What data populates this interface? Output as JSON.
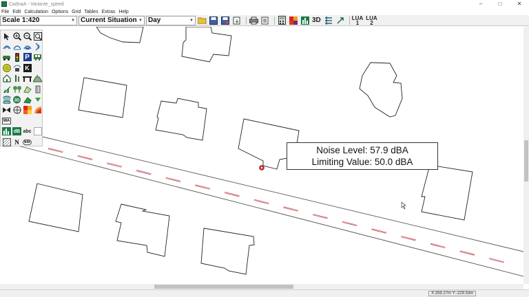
{
  "window": {
    "title": "CadnaA - Variante_speed",
    "minimize": "–",
    "maximize": "□",
    "close": "✕"
  },
  "menu": [
    "File",
    "Edit",
    "Calculation",
    "Options",
    "Grid",
    "Tables",
    "Extras",
    "Help"
  ],
  "toolbar": {
    "scale": "Scale 1:420",
    "variant": "Current Situation",
    "period": "Day",
    "label_3d": "3D",
    "lua1": "LUA\n1",
    "lua2": "LUA\n2",
    "icons": [
      "open-folder-icon",
      "save-icon",
      "save-as-icon",
      "import-icon",
      "print-icon",
      "export-icon",
      "calculator-icon",
      "grid-color-icon",
      "receiver-chart-icon",
      "3d-view-icon",
      "levels-icon",
      "antenna-icon"
    ]
  },
  "palette": {
    "items": [
      {
        "icon": "select-arrow-icon"
      },
      {
        "icon": "zoom-in-icon"
      },
      {
        "icon": "zoom-out-icon"
      },
      {
        "icon": "zoom-window-icon"
      },
      {
        "icon": "point-source-icon"
      },
      {
        "icon": "line-source-icon"
      },
      {
        "icon": "area-source-icon"
      },
      {
        "icon": "vertical-source-icon"
      },
      {
        "icon": "road-icon"
      },
      {
        "icon": "traffic-light-icon"
      },
      {
        "icon": "parking-icon",
        "text": "P"
      },
      {
        "icon": "railway-icon"
      },
      {
        "icon": "industry-icon"
      },
      {
        "icon": "receiver-icon"
      },
      {
        "icon": "cross-section-icon",
        "text": "K"
      },
      {
        "icon": "blank"
      },
      {
        "icon": "building-icon"
      },
      {
        "icon": "barrier-icon"
      },
      {
        "icon": "bridge-icon"
      },
      {
        "icon": "embankment-icon"
      },
      {
        "icon": "trees-icon"
      },
      {
        "icon": "vegetation-icon"
      },
      {
        "icon": "area-icon"
      },
      {
        "icon": "cylinder-icon"
      },
      {
        "icon": "tank-icon"
      },
      {
        "icon": "3d-reflector-icon"
      },
      {
        "icon": "ground-icon"
      },
      {
        "icon": "arrow-down-icon"
      },
      {
        "icon": "bowtie-icon"
      },
      {
        "icon": "group-icon"
      },
      {
        "icon": "color-grid-icon"
      },
      {
        "icon": "contour-icon"
      },
      {
        "icon": "wa-icon",
        "text": "WA"
      },
      {
        "icon": "blank"
      },
      {
        "icon": "blank"
      },
      {
        "icon": "blank"
      },
      {
        "icon": "receiver-grid-icon"
      },
      {
        "icon": "db-label-icon",
        "text": "dB"
      },
      {
        "icon": "text-icon",
        "text": "abc"
      },
      {
        "icon": "frame-icon"
      },
      {
        "icon": "hatch-icon"
      },
      {
        "icon": "north-arrow-icon",
        "text": "N"
      },
      {
        "icon": "km-marker-icon",
        "text": "km"
      },
      {
        "icon": "blank"
      }
    ]
  },
  "tooltip": {
    "noise_level": "Noise Level: 57.9 dBA",
    "limiting_value": "Limiting Value: 50.0 dBA"
  },
  "status": {
    "coordinates": "X:259.27m Y:-229.53m"
  },
  "colors": {
    "road_centerline": "#c0404a",
    "building_outline": "#222222",
    "receiver_marker": "#d03030"
  }
}
